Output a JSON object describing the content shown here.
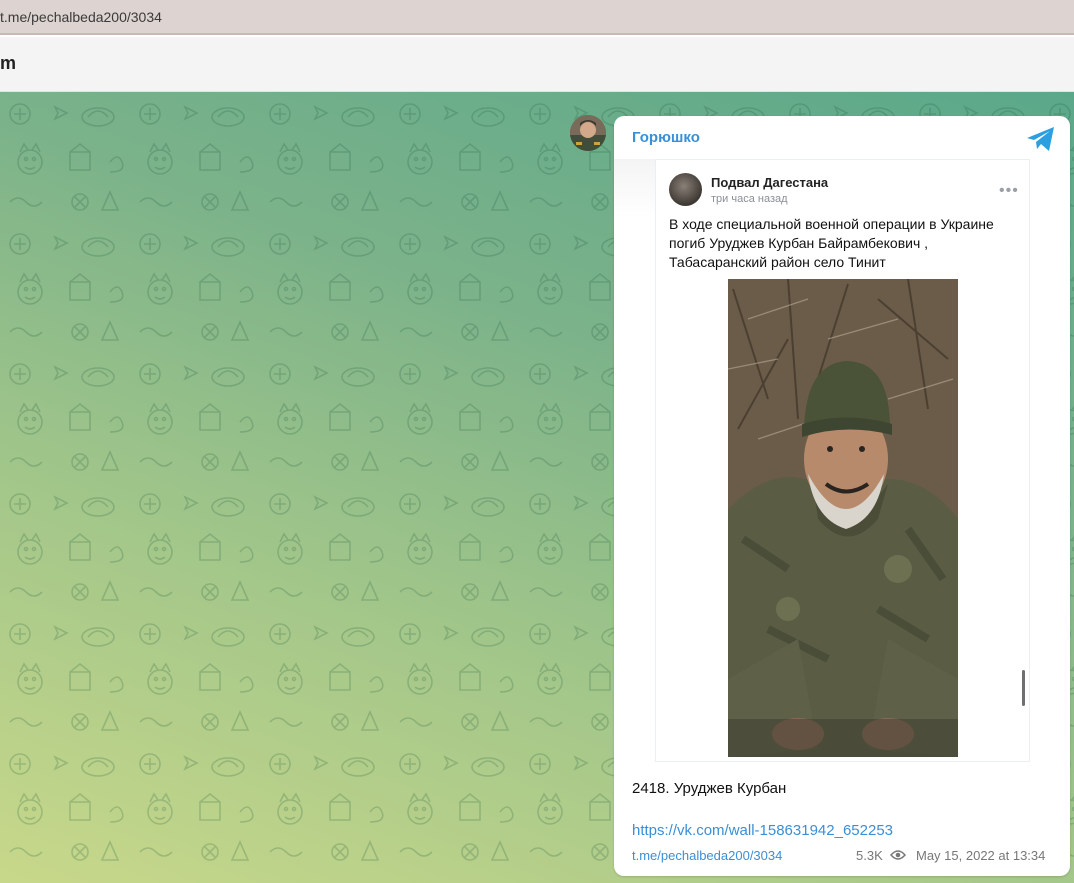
{
  "browser": {
    "url": "t.me/pechalbeda200/3034"
  },
  "header": {
    "title": "m"
  },
  "message": {
    "sender": "Горюшко",
    "embed": {
      "source_name": "Подвал Дагестана",
      "time": "три часа назад",
      "more": "•••",
      "text": "В ходе специальной военной операции в Украине погиб Уруджев Курбан Байрамбекович , Табасаранский район село Тинит"
    },
    "caption": "2418. Уруджев Курбан",
    "link": "https://vk.com/wall-158631942_652253",
    "footer": {
      "permalink": "t.me/pechalbeda200/3034",
      "views": "5.3K",
      "date": "May 15, 2022 at 13:34"
    }
  },
  "colors": {
    "accent": "#3a8fd6",
    "telegram": "#2aa0e0"
  },
  "icons": [
    "telegram-icon",
    "eye-icon",
    "more-icon"
  ]
}
